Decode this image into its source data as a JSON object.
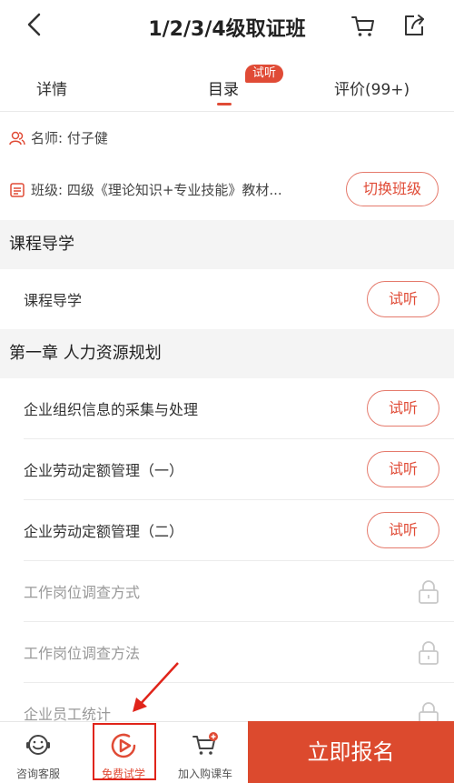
{
  "header": {
    "title": "1/2/3/4级取证班"
  },
  "tabs": [
    {
      "label": "详情"
    },
    {
      "label": "目录",
      "badge": "试听"
    },
    {
      "label": "评价(99+)"
    }
  ],
  "info": {
    "teacher": "名师: 付子健",
    "class": "班级: 四级《理论知识+专业技能》教材...",
    "switch_label": "切换班级"
  },
  "sections": [
    {
      "title": "课程导学",
      "lessons": [
        {
          "title": "课程导学",
          "action": "试听"
        }
      ]
    },
    {
      "title": "第一章 人力资源规划",
      "lessons": [
        {
          "title": "企业组织信息的采集与处理",
          "action": "试听"
        },
        {
          "title": "企业劳动定额管理（一）",
          "action": "试听"
        },
        {
          "title": "企业劳动定额管理（二）",
          "action": "试听"
        },
        {
          "title": "工作岗位调查方式",
          "locked": true
        },
        {
          "title": "工作岗位调查方法",
          "locked": true
        },
        {
          "title": "企业员工统计",
          "locked": true
        }
      ]
    }
  ],
  "bottom": {
    "service": "咨询客服",
    "free_trial": "免费试学",
    "add_cart": "加入购课车",
    "enroll": "立即报名"
  },
  "colors": {
    "accent": "#e04b36",
    "enroll_bg": "#dc4a2e"
  }
}
